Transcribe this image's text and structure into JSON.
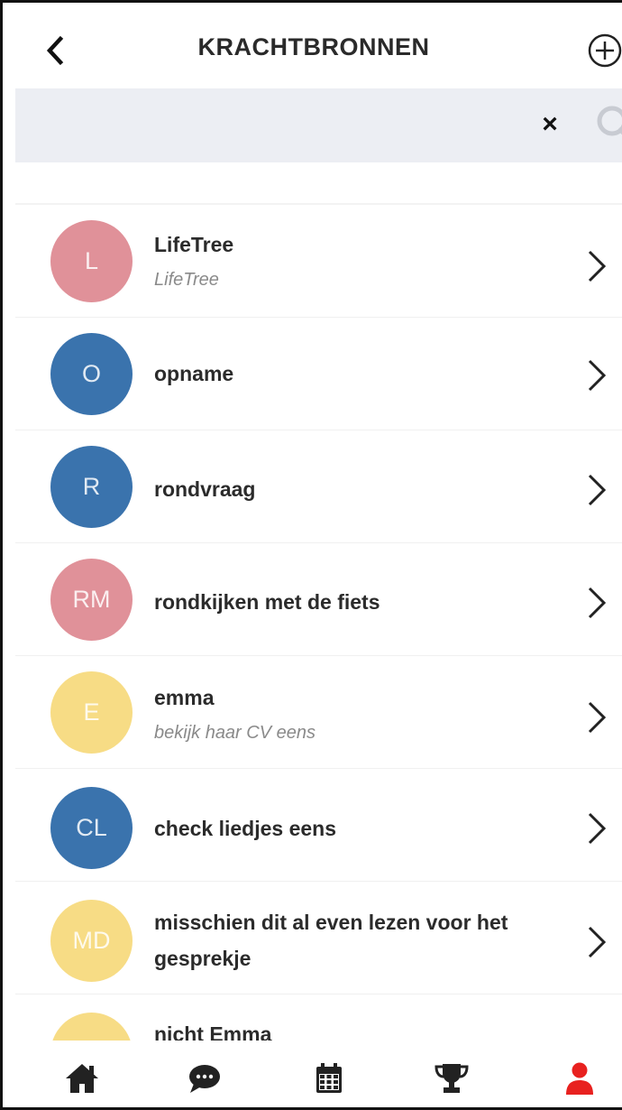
{
  "header": {
    "title": "KRACHTBRONNEN",
    "back_icon": "chevron-left-icon",
    "add_icon": "plus-circle-icon"
  },
  "search": {
    "value": "",
    "placeholder": "",
    "clear_label": "×",
    "search_icon": "search-icon"
  },
  "items": [
    {
      "initials": "L",
      "title": "LifeTree",
      "subtitle": "LifeTree",
      "color": "#e09199"
    },
    {
      "initials": "O",
      "title": "opname",
      "subtitle": "",
      "color": "#3a73ad"
    },
    {
      "initials": "R",
      "title": "rondvraag",
      "subtitle": "",
      "color": "#3a73ad"
    },
    {
      "initials": "RM",
      "title": "rondkijken met de fiets",
      "subtitle": "",
      "color": "#e09199"
    },
    {
      "initials": "E",
      "title": "emma",
      "subtitle": "bekijk haar CV eens",
      "color": "#f7dc85"
    },
    {
      "initials": "CL",
      "title": "check liedjes eens",
      "subtitle": "",
      "color": "#3a73ad"
    },
    {
      "initials": "MD",
      "title": "misschien dit al even lezen voor het gesprekje",
      "subtitle": "",
      "color": "#f7dc85"
    },
    {
      "initials": "",
      "title": "nicht Emma",
      "subtitle": "",
      "color": "#f7dc85"
    }
  ],
  "bottom_nav": {
    "items": [
      {
        "icon": "home-icon",
        "active": false
      },
      {
        "icon": "chat-icon",
        "active": false
      },
      {
        "icon": "calendar-icon",
        "active": false
      },
      {
        "icon": "trophy-icon",
        "active": false
      },
      {
        "icon": "user-icon",
        "active": true
      }
    ],
    "active_color": "#e8211f",
    "inactive_color": "#222222"
  }
}
